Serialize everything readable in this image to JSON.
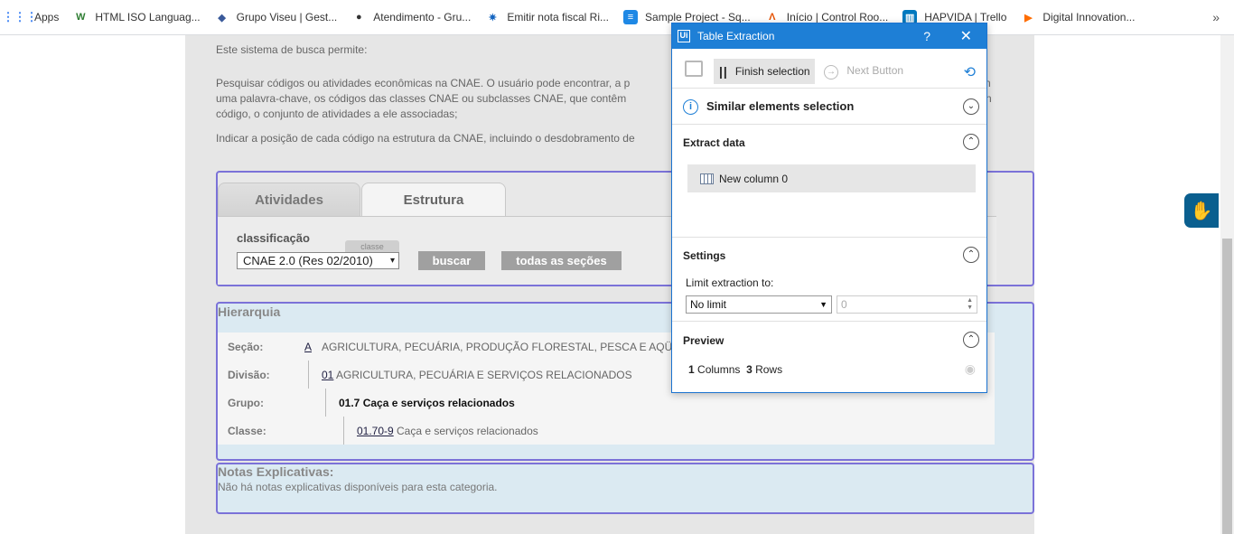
{
  "bookmarks": [
    {
      "label": "Apps",
      "icon": "apps-grid-icon",
      "color": "#4285f4"
    },
    {
      "label": "HTML ISO Languag...",
      "icon": "w3-icon",
      "color": "#2e7d32"
    },
    {
      "label": "Grupo Viseu | Gest...",
      "icon": "viseu-icon",
      "color": "#3a5a9a"
    },
    {
      "label": "Atendimento - Gru...",
      "icon": "atendimento-icon",
      "color": "#333333"
    },
    {
      "label": "Emitir nota fiscal Ri...",
      "icon": "nota-fiscal-icon",
      "color": "#1565c0"
    },
    {
      "label": "Sample Project - Sq...",
      "icon": "sample-project-icon",
      "color": "#1e88e5"
    },
    {
      "label": "Início | Control Roo...",
      "icon": "control-room-icon",
      "color": "#e65100"
    },
    {
      "label": "HAPVIDA | Trello",
      "icon": "trello-icon",
      "color": "#0079bf"
    },
    {
      "label": "Digital Innovation...",
      "icon": "dio-icon",
      "color": "#ff6d00"
    }
  ],
  "bookmarks_more": "»",
  "intro": {
    "line1": "Este sistema de busca permite:",
    "p2_l1": "Pesquisar códigos ou atividades econômicas na CNAE. O usuário pode encontrar, a p",
    "p2_l1_tail": "n",
    "p2_l2": "uma palavra-chave, os códigos das classes CNAE ou subclasses CNAE, que contêm",
    "p2_l2_tail": "n",
    "p2_l3": "código, o conjunto de atividades a ele associadas;",
    "p3": "Indicar a posição de cada código na estrutura da CNAE, incluindo o desdobramento de"
  },
  "tabs": {
    "atividades": "Atividades",
    "estrutura": "Estrutura"
  },
  "search": {
    "label": "classificação",
    "small_label": "classe",
    "select_value": "CNAE 2.0 (Res 02/2010)",
    "buscar": "buscar",
    "todas": "todas as seções"
  },
  "hierarquia": {
    "title": "Hierarquia",
    "rows": [
      {
        "key": "Seção:",
        "code": "A",
        "text": "AGRICULTURA, PECUÁRIA, PRODUÇÃO FLORESTAL, PESCA E AQÜ"
      },
      {
        "key": "Divisão:",
        "code": "01",
        "text": "AGRICULTURA, PECUÁRIA E SERVIÇOS RELACIONADOS"
      },
      {
        "key": "Grupo:",
        "code": "01.7 Caça e serviços relacionados",
        "text": ""
      },
      {
        "key": "Classe:",
        "code": "01.70-9",
        "text": "Caça e serviços relacionados"
      }
    ]
  },
  "notas": {
    "title": "Notas Explicativas:",
    "text": "Não há notas explicativas disponíveis para esta categoria."
  },
  "dialog": {
    "title": "Table Extraction",
    "logo": "Ui",
    "help": "?",
    "close": "✕",
    "finish": "Finish selection",
    "next": "Next Button",
    "similar": "Similar elements selection",
    "extract": "Extract data",
    "column": "New column 0",
    "settings": "Settings",
    "limit_label": "Limit extraction to:",
    "limit_value": "No limit",
    "limit_num": "0",
    "preview": "Preview",
    "preview_cols_n": "1",
    "preview_cols": "Columns",
    "preview_rows_n": "3",
    "preview_rows": "Rows"
  },
  "colors": {
    "accent": "#1e7fd6",
    "box_border": "#7b72d8",
    "panel_blue": "#dbeaf2"
  }
}
